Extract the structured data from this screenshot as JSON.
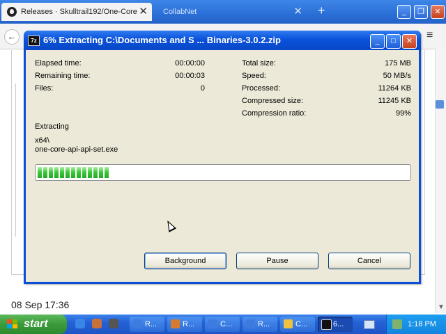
{
  "browser": {
    "tabs": [
      {
        "label": "Releases · Skulltrail192/One-Core",
        "close": "✕"
      },
      {
        "label": "CollabNet",
        "close": "✕"
      }
    ],
    "new_tab": "+",
    "window_buttons": {
      "minimize": "_",
      "maximize": "❐",
      "close": "✕"
    },
    "back": "←",
    "menu": "≡",
    "page_date": "08 Sep 17:36"
  },
  "dialog": {
    "app_icon": "7z",
    "title": "6% Extracting C:\\Documents and S ... Binaries-3.0.2.zip",
    "buttons": {
      "minimize": "_",
      "maximize": "□",
      "close": "✕"
    },
    "left_stats": [
      {
        "label": "Elapsed time:",
        "value": "00:00:00"
      },
      {
        "label": "Remaining time:",
        "value": "00:00:03"
      },
      {
        "label": "Files:",
        "value": "0"
      }
    ],
    "right_stats": [
      {
        "label": "Total size:",
        "value": "175 MB"
      },
      {
        "label": "Speed:",
        "value": "50 MB/s"
      },
      {
        "label": "Processed:",
        "value": "11264 KB"
      },
      {
        "label": "Compressed size:",
        "value": "11245 KB"
      },
      {
        "label": "Compression ratio:",
        "value": "99%"
      }
    ],
    "extracting_label": "Extracting",
    "current_path": "x64\\",
    "current_file": "one-core-api-api-set.exe",
    "progress_fraction": 0.2,
    "actions": {
      "background": "Background",
      "pause": "Pause",
      "cancel": "Cancel"
    }
  },
  "taskbar": {
    "start_label": "start",
    "tasks": [
      {
        "label": "R...",
        "icon_color": "#3d7be0"
      },
      {
        "label": "R...",
        "icon_color": "#d77b2e"
      },
      {
        "label": "C...",
        "icon_color": "#3d7be0"
      },
      {
        "label": "R...",
        "icon_color": "#3d7be0"
      },
      {
        "label": "C...",
        "icon_color": "#f0c040"
      },
      {
        "label": "6...",
        "icon_color": "#111111"
      }
    ],
    "clock": "1:18 PM"
  },
  "colors": {
    "xp_blue": "#0a4fd8",
    "dialog_face": "#ece9d8",
    "progress_green": "#3dc93b",
    "start_green": "#3a9a3a"
  }
}
